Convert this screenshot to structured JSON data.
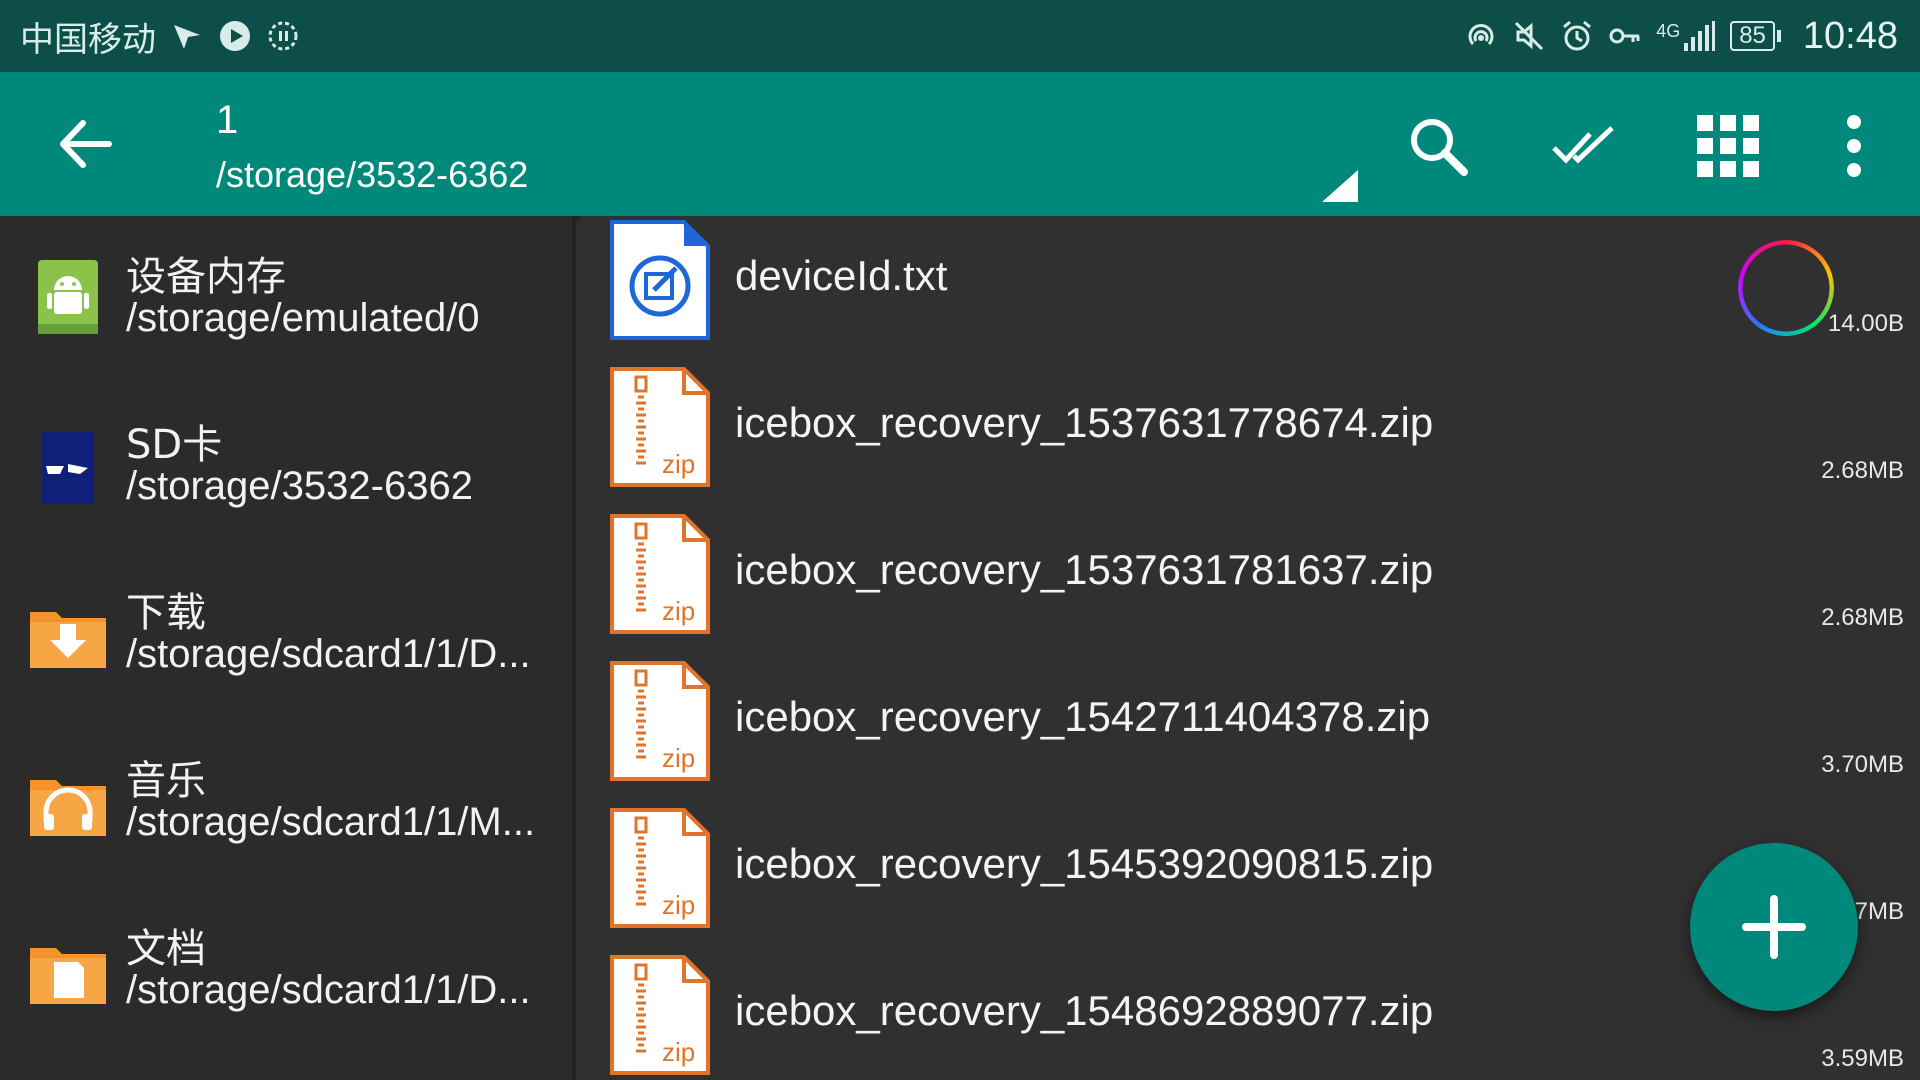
{
  "status_bar": {
    "carrier": "中国移动",
    "network": "4G",
    "battery": "85",
    "time": "10:48"
  },
  "toolbar": {
    "title": "1",
    "subtitle": "/storage/3532-6362",
    "actions": [
      "search-icon",
      "select-all-icon",
      "grid-view-icon",
      "more-vert-icon"
    ]
  },
  "sidebar": {
    "items": [
      {
        "name": "设备内存",
        "path": "/storage/emulated/0",
        "icon": "android-storage-icon"
      },
      {
        "name": "SD卡",
        "path": "/storage/3532-6362",
        "icon": "sd-card-icon"
      },
      {
        "name": "下载",
        "path": "/storage/sdcard1/1/D...",
        "icon": "download-folder-icon"
      },
      {
        "name": "音乐",
        "path": "/storage/sdcard1/1/M...",
        "icon": "music-folder-icon"
      },
      {
        "name": "文档",
        "path": "/storage/sdcard1/1/D...",
        "icon": "document-folder-icon"
      }
    ]
  },
  "files": [
    {
      "name": "deviceId.txt",
      "size": "14.00B",
      "type": "txt"
    },
    {
      "name": "icebox_recovery_1537631778674.zip",
      "size": "2.68MB",
      "type": "zip"
    },
    {
      "name": "icebox_recovery_1537631781637.zip",
      "size": "2.68MB",
      "type": "zip"
    },
    {
      "name": "icebox_recovery_1542711404378.zip",
      "size": "3.70MB",
      "type": "zip"
    },
    {
      "name": "icebox_recovery_1545392090815.zip",
      "size": "7MB",
      "type": "zip"
    },
    {
      "name": "icebox_recovery_1548692889077.zip",
      "size": "3.59MB",
      "type": "zip"
    }
  ],
  "zip_label": "zip",
  "colors": {
    "primary": "#00897b",
    "status_bar": "#0d4f48",
    "background": "#303030",
    "sidebar": "#2b2b2b",
    "folder": "#f5932a"
  }
}
